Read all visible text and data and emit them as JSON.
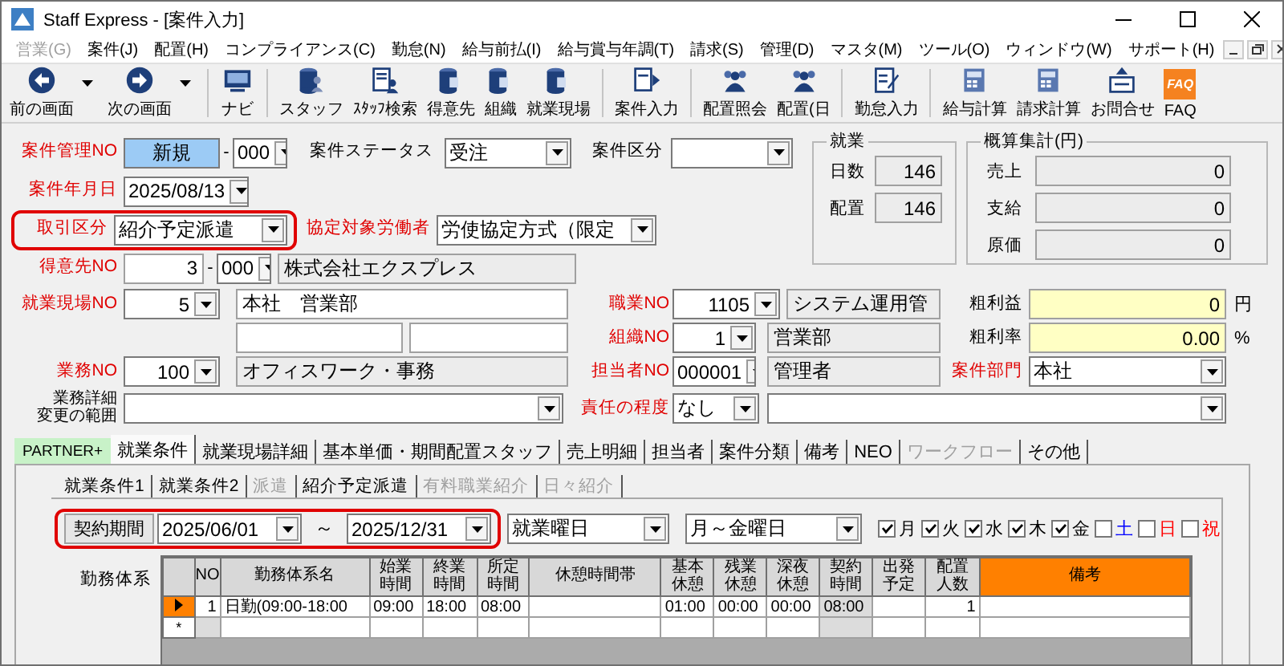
{
  "window": {
    "title": "Staff Express - [案件入力]"
  },
  "menu": [
    {
      "label": "営業(G)",
      "disabled": true
    },
    {
      "label": "案件(J)",
      "disabled": false
    },
    {
      "label": "配置(H)",
      "disabled": false
    },
    {
      "label": "コンプライアンス(C)",
      "disabled": false
    },
    {
      "label": "勤怠(N)",
      "disabled": false
    },
    {
      "label": "給与前払(I)",
      "disabled": false
    },
    {
      "label": "給与賞与年調(T)",
      "disabled": false
    },
    {
      "label": "請求(S)",
      "disabled": false
    },
    {
      "label": "管理(D)",
      "disabled": false
    },
    {
      "label": "マスタ(M)",
      "disabled": false
    },
    {
      "label": "ツール(O)",
      "disabled": false
    },
    {
      "label": "ウィンドウ(W)",
      "disabled": false
    },
    {
      "label": "サポート(H)",
      "disabled": false
    }
  ],
  "toolbar": [
    {
      "label": "前の画面",
      "dropdown": true
    },
    {
      "label": "次の画面",
      "dropdown": true
    },
    {
      "label": "ナビ",
      "dropdown": false
    },
    {
      "label": "スタッフ",
      "dropdown": false
    },
    {
      "label": "ｽﾀｯﾌ検索",
      "dropdown": false
    },
    {
      "label": "得意先",
      "dropdown": false
    },
    {
      "label": "組織",
      "dropdown": false
    },
    {
      "label": "就業現場",
      "dropdown": false
    },
    {
      "label": "案件入力",
      "dropdown": false
    },
    {
      "label": "配置照会",
      "dropdown": false
    },
    {
      "label": "配置(日",
      "dropdown": false
    },
    {
      "label": "勤怠入力",
      "dropdown": false
    },
    {
      "label": "給与計算",
      "dropdown": false
    },
    {
      "label": "請求計算",
      "dropdown": false
    },
    {
      "label": "お問合せ",
      "dropdown": false
    },
    {
      "label": "FAQ",
      "dropdown": false,
      "icon_text": "FAQ"
    }
  ],
  "form": {
    "top_rows": [
      [
        {
          "kind": "label",
          "text": "案件管理NO",
          "required": true
        },
        {
          "kind": "key",
          "value": "新規"
        },
        {
          "kind": "dash",
          "text": "-"
        },
        {
          "kind": "combo",
          "value": "000"
        },
        {
          "kind": "label",
          "text": "案件ステータス",
          "required": false
        },
        {
          "kind": "combo",
          "value": "受注"
        },
        {
          "kind": "label",
          "text": "案件区分",
          "required": false
        },
        {
          "kind": "combo"
        }
      ],
      [
        {
          "kind": "label",
          "text": "案件年月日",
          "required": true
        },
        {
          "kind": "combo",
          "value": "2025/08/13"
        }
      ],
      [
        {
          "kind": "group",
          "annotated": true,
          "items": [
            {
              "kind": "label",
              "text": "取引区分",
              "required": true
            },
            {
              "kind": "combo",
              "value": "紹介予定派遣"
            }
          ]
        },
        {
          "kind": "label",
          "text": "協定対象労働者",
          "required": true
        },
        {
          "kind": "combo",
          "value": "労使協定方式（限定"
        }
      ],
      [
        {
          "kind": "label",
          "text": "得意先NO",
          "required": true
        },
        {
          "kind": "field",
          "value": "3",
          "readonly": false
        },
        {
          "kind": "dash",
          "text": "-"
        },
        {
          "kind": "combo",
          "value": "000"
        },
        {
          "kind": "field",
          "value": "株式会社エクスプレス",
          "readonly": true
        }
      ]
    ],
    "employment": {
      "title": "就業",
      "rows": [
        {
          "label": "日数",
          "value": "146"
        },
        {
          "label": "配置",
          "value": "146"
        }
      ]
    },
    "estimate": {
      "title": "概算集計(円)",
      "rows": [
        {
          "label": "売上",
          "value": "0"
        },
        {
          "label": "支給",
          "value": "0"
        },
        {
          "label": "原価",
          "value": "0"
        }
      ]
    },
    "bottom_rows": [
      [
        {
          "kind": "label",
          "text": "就業現場NO",
          "required": true
        },
        {
          "kind": "combo",
          "value": "5"
        },
        {
          "kind": "field",
          "value": "本社　営業部",
          "readonly": false
        },
        {
          "kind": "label",
          "text": "職業NO",
          "required": true
        },
        {
          "kind": "combo",
          "value": "1105"
        },
        {
          "kind": "field",
          "value": "システム運用管",
          "readonly": true
        },
        {
          "kind": "label",
          "text": "粗利益",
          "required": false
        },
        {
          "kind": "total",
          "value": "0"
        },
        {
          "kind": "unit",
          "text": "円"
        }
      ],
      [
        {
          "kind": "field",
          "readonly": false
        },
        {
          "kind": "field",
          "readonly": false
        },
        {
          "kind": "label",
          "text": "組織NO",
          "required": true
        },
        {
          "kind": "combo",
          "value": "1"
        },
        {
          "kind": "field",
          "value": "営業部",
          "readonly": true
        },
        {
          "kind": "label",
          "text": "粗利率",
          "required": false
        },
        {
          "kind": "total",
          "value": "0.00"
        },
        {
          "kind": "unit",
          "text": "%"
        }
      ],
      [
        {
          "kind": "label",
          "text": "業務NO",
          "required": true
        },
        {
          "kind": "combo",
          "value": "100"
        },
        {
          "kind": "field",
          "value": "オフィスワーク・事務",
          "readonly": true
        },
        {
          "kind": "label",
          "text": "担当者NO",
          "required": true
        },
        {
          "kind": "combo",
          "value": "000001"
        },
        {
          "kind": "field",
          "value": "管理者",
          "readonly": true
        },
        {
          "kind": "label",
          "text": "案件部門",
          "required": true
        },
        {
          "kind": "combo",
          "value": "本社"
        }
      ],
      [
        {
          "kind": "label",
          "lines": [
            "業務詳細",
            "変更の範囲"
          ],
          "required": false
        },
        {
          "kind": "combo"
        },
        {
          "kind": "label",
          "text": "責任の程度",
          "required": true
        },
        {
          "kind": "combo",
          "value": "なし"
        },
        {
          "kind": "combo"
        }
      ]
    ]
  },
  "tabs": {
    "tag": "PARTNER+",
    "items": [
      {
        "label": "就業条件",
        "selected": true,
        "disabled": false
      },
      {
        "label": "就業現場詳細",
        "selected": false,
        "disabled": false
      },
      {
        "label": "基本単価・期間配置スタッフ",
        "selected": false,
        "disabled": false
      },
      {
        "label": "売上明細",
        "selected": false,
        "disabled": false
      },
      {
        "label": "担当者",
        "selected": false,
        "disabled": false
      },
      {
        "label": "案件分類",
        "selected": false,
        "disabled": false
      },
      {
        "label": "備考",
        "selected": false,
        "disabled": false
      },
      {
        "label": "NEO",
        "selected": false,
        "disabled": false
      },
      {
        "label": "ワークフロー",
        "selected": false,
        "disabled": true
      },
      {
        "label": "その他",
        "selected": false,
        "disabled": false
      }
    ]
  },
  "subtabs": [
    {
      "label": "就業条件1",
      "disabled": false
    },
    {
      "label": "就業条件2",
      "disabled": false
    },
    {
      "label": "派遣",
      "disabled": true
    },
    {
      "label": "紹介予定派遣",
      "disabled": false
    },
    {
      "label": "有料職業紹介",
      "disabled": true
    },
    {
      "label": "日々紹介",
      "disabled": true
    }
  ],
  "contract": {
    "annotated": true,
    "button": "契約期間",
    "start": "2025/06/01",
    "separator": "～",
    "end": "2025/12/31",
    "workdays_mode": "就業曜日",
    "workdays": "月～金曜日",
    "days": [
      {
        "label": "月",
        "checked": true,
        "color": "#000000"
      },
      {
        "label": "火",
        "checked": true,
        "color": "#000000"
      },
      {
        "label": "水",
        "checked": true,
        "color": "#000000"
      },
      {
        "label": "木",
        "checked": true,
        "color": "#000000"
      },
      {
        "label": "金",
        "checked": true,
        "color": "#000000"
      },
      {
        "label": "土",
        "checked": false,
        "color": "#0000ff"
      },
      {
        "label": "日",
        "checked": false,
        "color": "#ff0000"
      },
      {
        "label": "祝",
        "checked": false,
        "color": "#ff0000"
      }
    ]
  },
  "shift_table": {
    "label": "勤務体系",
    "columns": [
      {
        "label": "NO",
        "computed": false,
        "highlighted": false
      },
      {
        "label": "勤務体系名",
        "computed": false,
        "highlighted": false
      },
      {
        "label": "始業時間",
        "computed": false,
        "highlighted": false
      },
      {
        "label": "終業時間",
        "computed": false,
        "highlighted": false
      },
      {
        "label": "所定時間",
        "computed": false,
        "highlighted": false
      },
      {
        "label": "休憩時間帯",
        "computed": false,
        "highlighted": false
      },
      {
        "label": "基本休憩",
        "computed": false,
        "highlighted": false
      },
      {
        "label": "残業休憩",
        "computed": false,
        "highlighted": false
      },
      {
        "label": "深夜休憩",
        "computed": false,
        "highlighted": false
      },
      {
        "label": "契約時間",
        "computed": true,
        "highlighted": false
      },
      {
        "label": "出発予定",
        "computed": false,
        "highlighted": false
      },
      {
        "label": "配置人数",
        "computed": false,
        "highlighted": false
      },
      {
        "label": "備考",
        "computed": false,
        "highlighted": true
      }
    ],
    "rows": [
      {
        "kind": "record",
        "current": true,
        "cells": [
          "1",
          "日勤(09:00-18:00",
          "09:00",
          "18:00",
          "08:00",
          null,
          "01:00",
          "00:00",
          "00:00",
          "08:00",
          null,
          "1",
          null
        ]
      },
      {
        "kind": "new",
        "current": false,
        "marker": "*"
      }
    ]
  }
}
